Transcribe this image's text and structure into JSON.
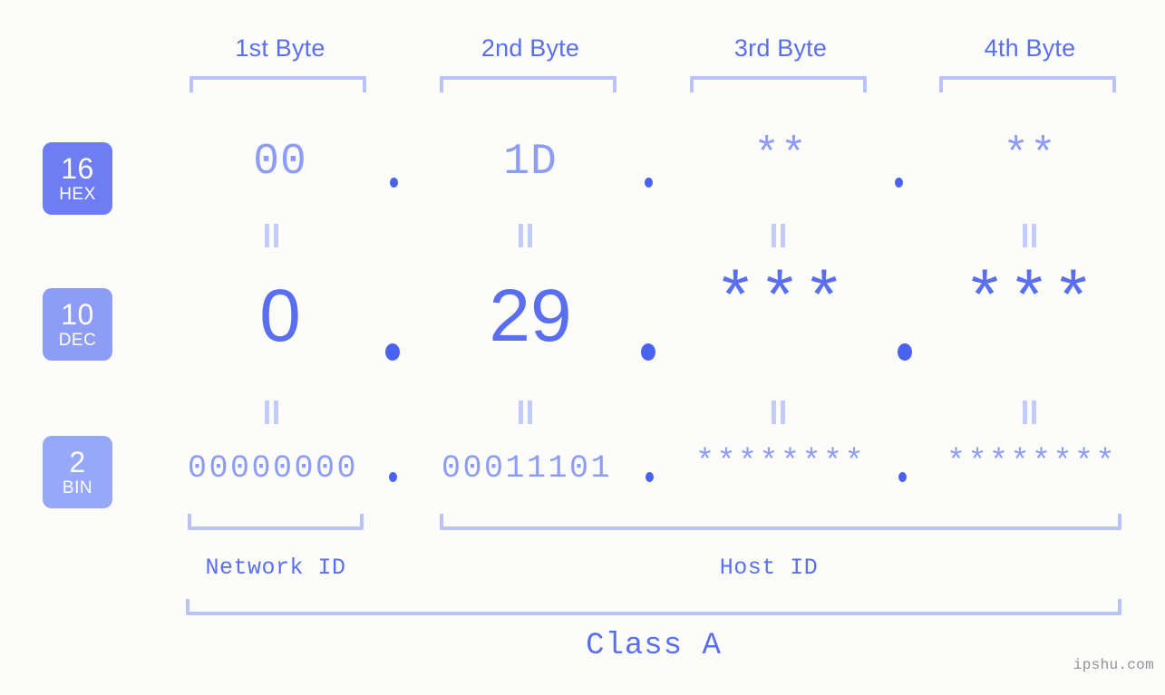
{
  "page": {
    "background_color": "#fcfdfa",
    "accent_color": "#5a6ff0",
    "accent_light_color": "#8d9cf5",
    "bracket_color": "#b9c2fb",
    "dot_color": "#4a63ee"
  },
  "byte_headers": [
    {
      "label": "1st Byte"
    },
    {
      "label": "2nd Byte"
    },
    {
      "label": "3rd Byte"
    },
    {
      "label": "4th Byte"
    }
  ],
  "bases": [
    {
      "num": "16",
      "label": "HEX",
      "color": "#6e7ef2"
    },
    {
      "num": "10",
      "label": "DEC",
      "color": "#8d9cf5"
    },
    {
      "num": "2",
      "label": "BIN",
      "color": "#96a8f7"
    }
  ],
  "rows": {
    "hex": {
      "base_num": "16",
      "base_label": "HEX",
      "values": [
        "00",
        "1D",
        "**",
        "**"
      ]
    },
    "dec": {
      "base_num": "10",
      "base_label": "DEC",
      "values": [
        "0",
        "29",
        "***",
        "***"
      ]
    },
    "bin": {
      "base_num": "2",
      "base_label": "BIN",
      "values": [
        "00000000",
        "00011101",
        "********",
        "********"
      ]
    }
  },
  "separators": {
    "symbol": ".",
    "count_per_row": 3
  },
  "equality_marks": {
    "symbol": "=",
    "rows": 2,
    "columns": 4
  },
  "id_labels": [
    {
      "name": "Network ID"
    },
    {
      "name": "Host ID"
    }
  ],
  "class_label": "Class A",
  "watermark": "ipshu.com"
}
